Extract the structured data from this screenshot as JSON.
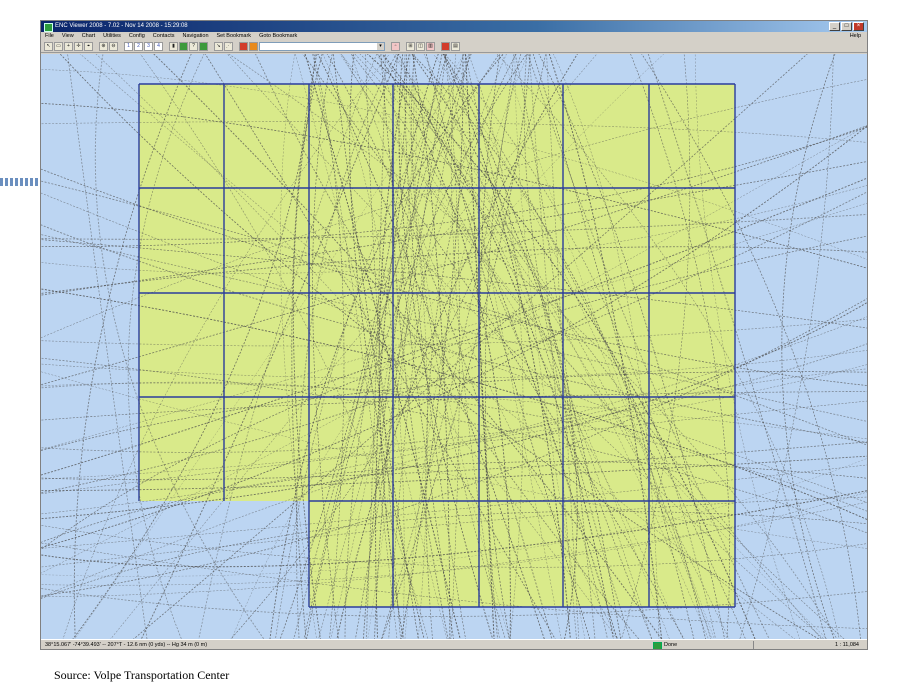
{
  "window": {
    "title": "ENC Viewer 2008 - 7.02 - Nov 14 2008 - 15:29:08"
  },
  "menu": {
    "items": [
      "File",
      "View",
      "Chart",
      "Utilities",
      "Config",
      "Contacts",
      "Navigation",
      "Set Bookmark",
      "Goto Bookmark"
    ],
    "help": "Help"
  },
  "toolbar": {
    "zoom_levels": [
      "1",
      "2",
      "3",
      "4"
    ]
  },
  "map": {
    "land_color": "#bcd5f2",
    "cell_color": "#d9ea8a",
    "grid_color": "#2b3c9c",
    "track_color": "#4a4a4a"
  },
  "status": {
    "coordinates": "38°15.067' -74°39.493'  --  207°T - 12.6 nm (0 yds)  --  Hg 34 m (0 m)",
    "state": "Done",
    "scale": "1 : 11,084"
  },
  "caption": "Source: Volpe Transportation Center"
}
